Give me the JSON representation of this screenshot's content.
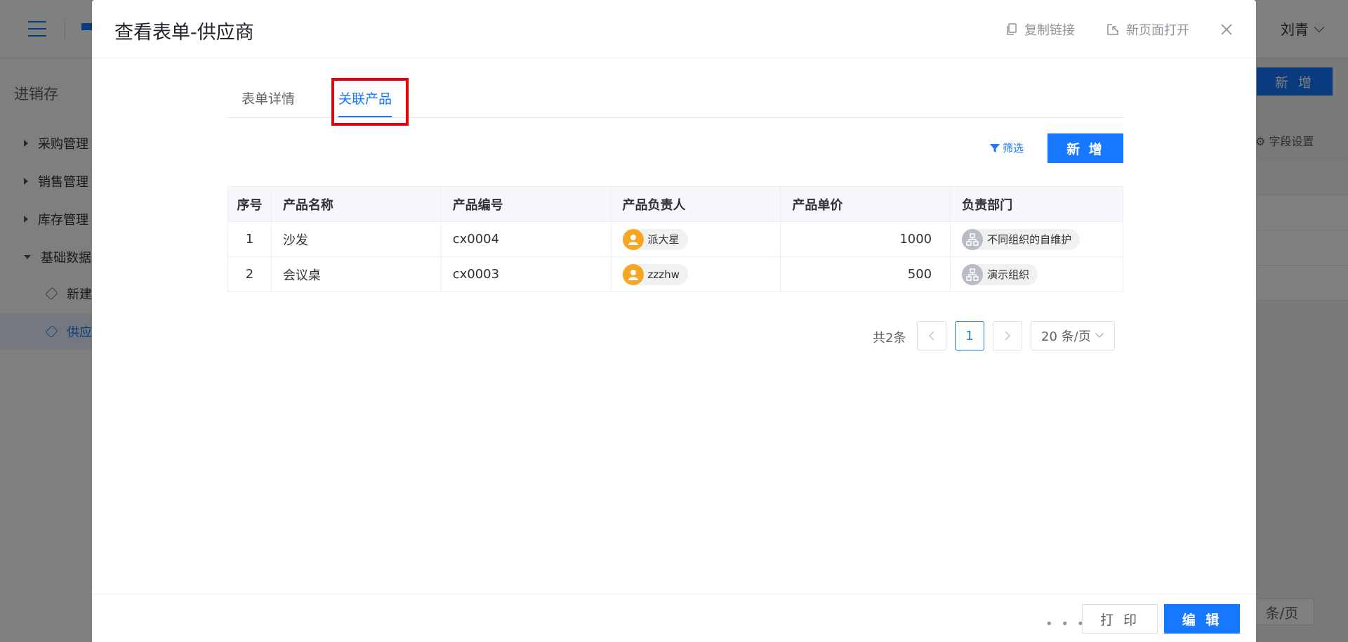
{
  "background": {
    "user_name": "刘青",
    "sidebar_title": "进销存",
    "sidebar_items": [
      {
        "label": "采购管理",
        "expanded": false
      },
      {
        "label": "销售管理",
        "expanded": false
      },
      {
        "label": "库存管理",
        "expanded": false
      },
      {
        "label": "基础数据",
        "expanded": true
      }
    ],
    "sidebar_sub_items": [
      {
        "label": "新建",
        "active": false
      },
      {
        "label": "供应",
        "active": true
      }
    ],
    "add_button_label": "新 增",
    "field_settings_label": "字段设置",
    "pager_size_label": "条/页"
  },
  "dialog": {
    "title": "查看表单-供应商",
    "copy_link_label": "复制链接",
    "open_new_page_label": "新页面打开",
    "tabs": [
      {
        "label": "表单详情",
        "active": false
      },
      {
        "label": "关联产品",
        "active": true
      }
    ],
    "filter_label": "筛选",
    "new_button_label": "新 增",
    "table": {
      "columns": [
        "序号",
        "产品名称",
        "产品编号",
        "产品负责人",
        "产品单价",
        "负责部门"
      ],
      "rows": [
        {
          "index": "1",
          "name": "沙发",
          "code": "cx0004",
          "owner": "派大星",
          "price": "1000",
          "dept": "不同组织的自维护"
        },
        {
          "index": "2",
          "name": "会议桌",
          "code": "cx0003",
          "owner": "zzzhw",
          "price": "500",
          "dept": "演示组织"
        }
      ]
    },
    "pagination": {
      "total_label": "共2条",
      "current_page": "1",
      "page_size_label": "20 条/页"
    },
    "footer": {
      "more_label": "• • •",
      "print_label": "打 印",
      "edit_label": "编 辑"
    }
  },
  "colors": {
    "primary": "#1677ff",
    "highlight": "#e6000b",
    "avatar_user": "#f5a623",
    "avatar_org": "#b8bcc4"
  }
}
